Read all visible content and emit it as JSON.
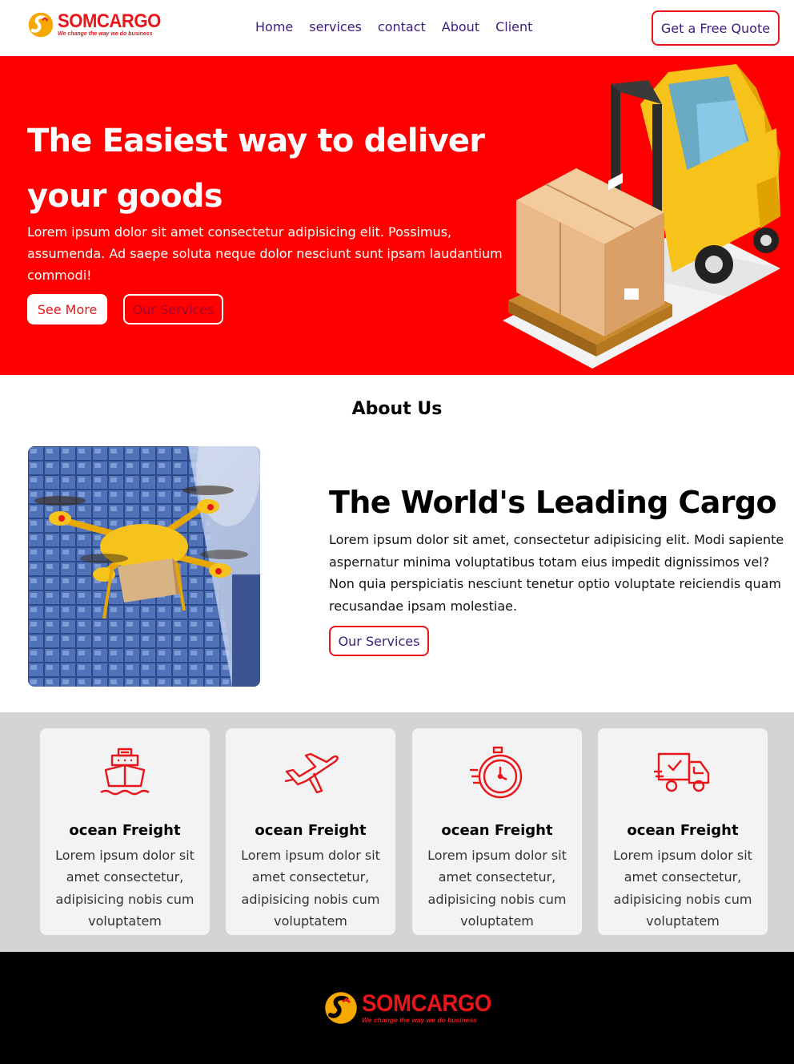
{
  "brand": {
    "name": "SOMCARGO",
    "tagline": "We change the way we do business"
  },
  "nav": {
    "links": [
      "Home",
      "services",
      "contact",
      "About",
      "Client"
    ],
    "cta": "Get a Free Quote"
  },
  "hero": {
    "heading": "The Easiest way to deliver your goods",
    "text": "Lorem ipsum dolor sit amet consectetur adipisicing elit. Possimus, assumenda. Ad saepe soluta neque dolor nesciunt sunt ipsam laudantium commodi!",
    "primary_button": "See More",
    "secondary_button": "Our Services"
  },
  "about": {
    "section_title": "About Us",
    "heading": "The World's Leading Cargo",
    "text": "Lorem ipsum dolor sit amet, consectetur adipisicing elit. Modi sapiente aspernatur minima voluptatibus totam eius impedit dignissimos vel? Non quia perspiciatis nesciunt tenetur optio voluptate reiciendis quam recusandae ipsam molestiae.",
    "button": "Our Services"
  },
  "services": [
    {
      "icon": "ship-icon",
      "title": "ocean Freight",
      "text": "Lorem ipsum dolor sit amet consectetur, adipisicing nobis cum voluptatem"
    },
    {
      "icon": "airplane-icon",
      "title": "ocean Freight",
      "text": "Lorem ipsum dolor sit amet consectetur, adipisicing nobis cum voluptatem"
    },
    {
      "icon": "stopwatch-icon",
      "title": "ocean Freight",
      "text": "Lorem ipsum dolor sit amet consectetur, adipisicing nobis cum voluptatem"
    },
    {
      "icon": "delivery-truck-icon",
      "title": "ocean Freight",
      "text": "Lorem ipsum dolor sit amet consectetur, adipisicing nobis cum voluptatem"
    }
  ],
  "colors": {
    "primary_red": "#ff0000",
    "accent_red": "#e8161b",
    "nav_text": "#3b1e7a",
    "logo_yellow": "#f5a800",
    "services_bg": "#d4d4d4",
    "footer_bg": "#000000"
  }
}
